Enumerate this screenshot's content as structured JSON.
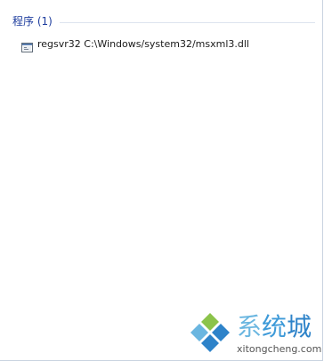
{
  "search_results": {
    "group_title": "程序 (1)",
    "items": [
      {
        "label": "regsvr32 C:\\Windows/system32/msxml3.dll",
        "icon": "console-window-icon"
      }
    ]
  },
  "watermark": {
    "site_name_cn": "系统城",
    "site_name_chars": [
      "系",
      "统",
      "城"
    ],
    "site_domain": "xitongcheng.com",
    "colors": {
      "blue": "#2e83c9",
      "light_blue": "#6ab6e0",
      "green": "#8bc34a"
    }
  },
  "colors": {
    "group_header_text": "#1e3d9e",
    "background": "#ffffff"
  }
}
